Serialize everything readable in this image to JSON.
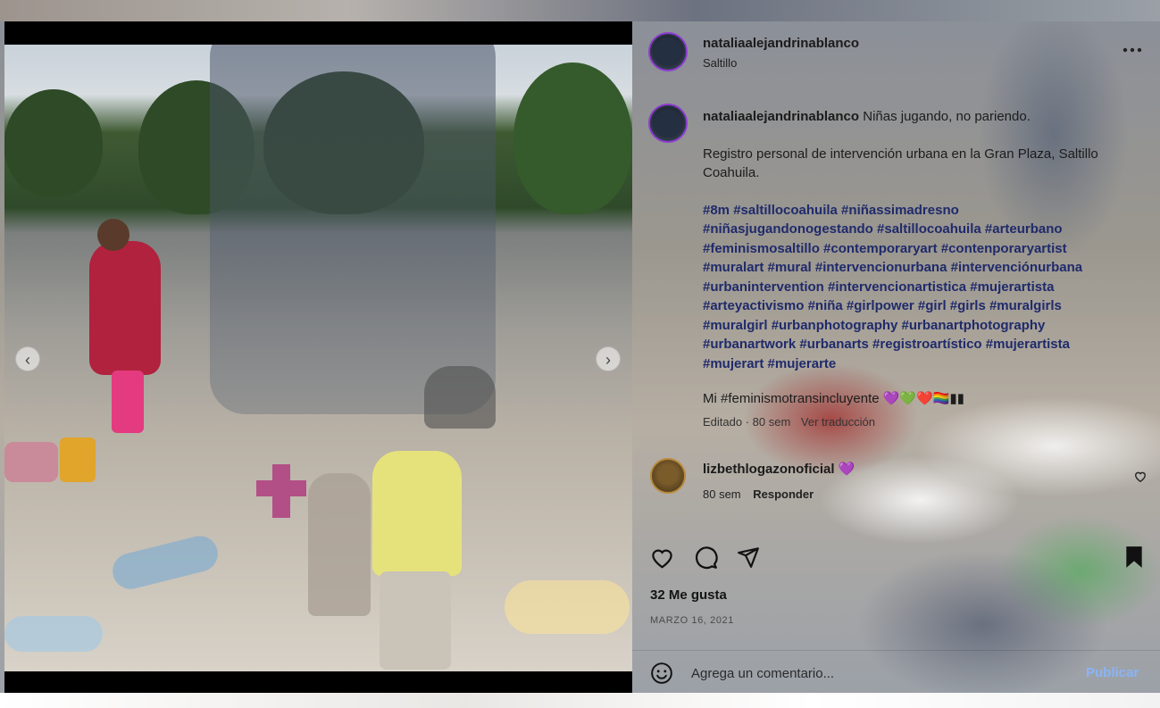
{
  "post": {
    "author": "nataliaalejandrinablanco",
    "location": "Saltillo",
    "more_icon": "ellipsis-icon"
  },
  "caption": {
    "author": "nataliaalejandrinablanco",
    "title": "Niñas jugando, no pariendo.",
    "body": "Registro personal de intervención urbana en la Gran Plaza, Saltillo Coahuila.",
    "hashtags": "#8m #saltillocoahuila #niñassimadresno #niñasjugandonogestando #saltillocoahuila #arteurbano #feminismosaltillo #contemporaryart #contenporaryartist #muralart #mural #intervencionurbana #intervenciónurbana #urbanintervention #intervencionartistica #mujerartista #arteyactivismo #niña #girlpower #girl #girls #muralgirls #muralgirl #urbanphotography #urbanartphotography #urbanartwork #urbanarts #registroartístico #mujerartista #mujerart #mujerarte",
    "closing": "Mi #feminismotransincluyente 💜💚❤️🏳️‍🌈▮▮",
    "edited": "Editado · 80 sem",
    "translate": "Ver traducción"
  },
  "comment": {
    "author": "lizbethlogazonoficial",
    "text": "💜",
    "time": "80 sem",
    "reply_label": "Responder"
  },
  "actions": {
    "like_icon": "heart-icon",
    "comment_icon": "comment-icon",
    "share_icon": "send-icon",
    "save_icon": "bookmark-icon"
  },
  "stats": {
    "likes": "32 Me gusta",
    "date": "MARZO 16, 2021"
  },
  "composer": {
    "emoji_icon": "smiley-icon",
    "placeholder": "Agrega un comentario...",
    "publish_label": "Publicar"
  },
  "media": {
    "prev_icon": "chevron-left-icon",
    "next_icon": "chevron-right-icon"
  }
}
